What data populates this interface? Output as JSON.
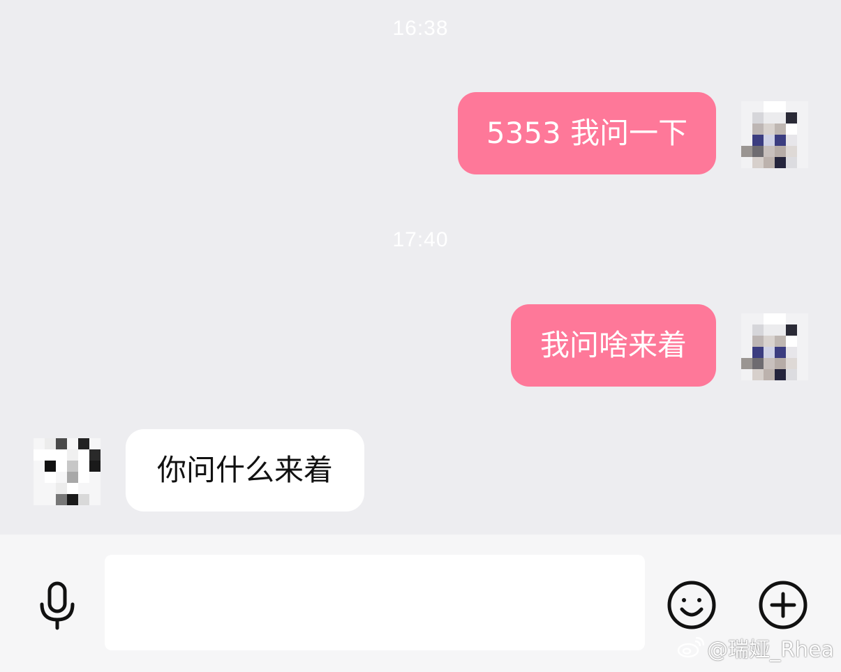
{
  "messages": [
    {
      "timestamp": "16:38",
      "direction": "out",
      "text": "5353 我问一下"
    },
    {
      "timestamp": "17:40",
      "direction": "out",
      "text": "我问啥来着"
    },
    {
      "timestamp": "",
      "direction": "in",
      "text": "你问什么来着"
    }
  ],
  "composer": {
    "input_value": "",
    "voice_icon": "microphone-icon",
    "emoji_icon": "smiley-icon",
    "more_icon": "plus-circle-icon"
  },
  "watermark": {
    "text": "@瑞娅_Rhea",
    "logo": "weibo-logo"
  },
  "colors": {
    "background": "#ededf0",
    "outgoing_bubble": "#fe7899",
    "incoming_bubble": "#ffffff",
    "composer_bar": "#f6f6f7"
  }
}
